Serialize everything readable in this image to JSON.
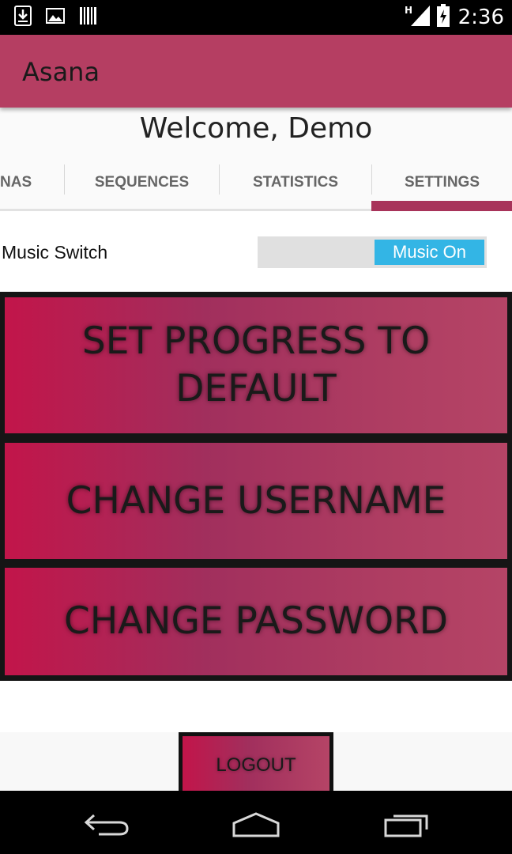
{
  "status_bar": {
    "time": "2:36",
    "network_type": "H",
    "icons": [
      "download-icon",
      "image-icon",
      "barcode-icon",
      "signal-icon",
      "battery-charging-icon"
    ]
  },
  "app_bar": {
    "title": "Asana",
    "color": "#b53e62"
  },
  "welcome": "Welcome, Demo",
  "tabs": [
    {
      "label": "NAS"
    },
    {
      "label": "SEQUENCES"
    },
    {
      "label": "STATISTICS"
    },
    {
      "label": "SETTINGS",
      "selected": true
    }
  ],
  "settings": {
    "music_label": "Music Switch",
    "music_toggle": {
      "label": "Music On",
      "state": "on",
      "color": "#33b5e5"
    }
  },
  "buttons": {
    "set_progress": {
      "line1": "SET PROGRESS TO",
      "line2": "DEFAULT"
    },
    "change_username": "CHANGE USERNAME",
    "change_password": "CHANGE PASSWORD",
    "logout": "LOGOUT"
  },
  "nav_bar": {
    "icons": [
      "back-icon",
      "home-icon",
      "recent-apps-icon"
    ]
  }
}
